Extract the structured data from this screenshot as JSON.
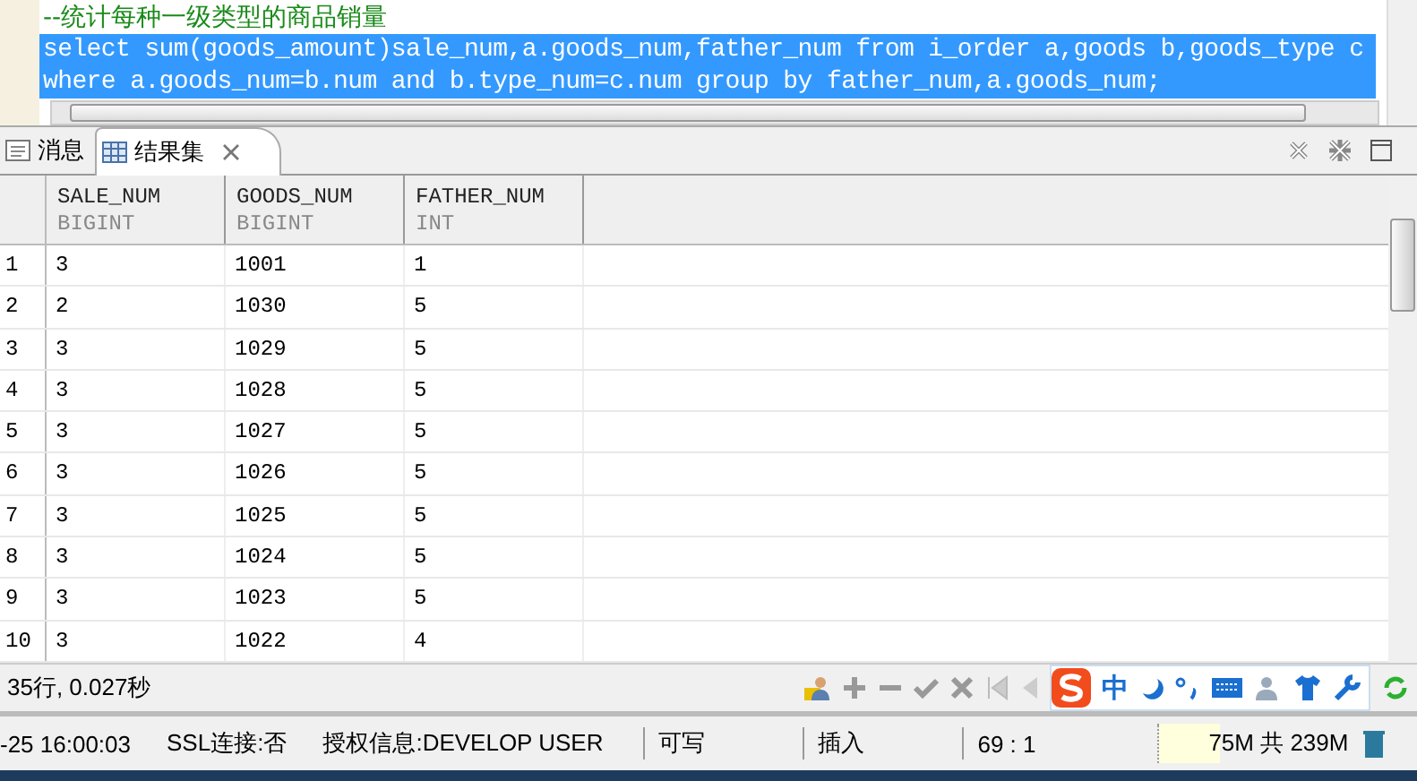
{
  "editor": {
    "lines": [
      {
        "text": "--统计每种一级类型的商品销量",
        "kind": "comment",
        "selected": false
      },
      {
        "text": "select sum(goods_amount)sale_num,a.goods_num,father_num from i_order a,goods b,goods_type c",
        "kind": "code",
        "selected": true
      },
      {
        "text": "where a.goods_num=b.num and b.type_num=c.num group by father_num,a.goods_num;",
        "kind": "code",
        "selected": true
      }
    ]
  },
  "tabs": [
    {
      "label": "消息",
      "selected": false,
      "closable": false
    },
    {
      "label": "结果集",
      "selected": true,
      "closable": true
    }
  ],
  "table": {
    "columns": [
      {
        "name": "SALE_NUM",
        "type": "BIGINT"
      },
      {
        "name": "GOODS_NUM",
        "type": "BIGINT"
      },
      {
        "name": "FATHER_NUM",
        "type": "INT"
      }
    ],
    "rows": [
      {
        "n": "1",
        "cells": [
          "3",
          "1001",
          "1"
        ]
      },
      {
        "n": "2",
        "cells": [
          "2",
          "1030",
          "5"
        ]
      },
      {
        "n": "3",
        "cells": [
          "3",
          "1029",
          "5"
        ]
      },
      {
        "n": "4",
        "cells": [
          "3",
          "1028",
          "5"
        ]
      },
      {
        "n": "5",
        "cells": [
          "3",
          "1027",
          "5"
        ]
      },
      {
        "n": "6",
        "cells": [
          "3",
          "1026",
          "5"
        ]
      },
      {
        "n": "7",
        "cells": [
          "3",
          "1025",
          "5"
        ]
      },
      {
        "n": "8",
        "cells": [
          "3",
          "1024",
          "5"
        ]
      },
      {
        "n": "9",
        "cells": [
          "3",
          "1023",
          "5"
        ]
      },
      {
        "n": "10",
        "cells": [
          "3",
          "1022",
          "4"
        ]
      }
    ]
  },
  "result_info": "35行, 0.027秒",
  "ime": {
    "mode": "中"
  },
  "status_bar": {
    "items": [
      "-25 16:00:03",
      "SSL连接:否",
      "授权信息:DEVELOP USER",
      "可写",
      "插入",
      "69 : 1"
    ],
    "memory": {
      "text": "75M 共 239M",
      "level": 0.31
    }
  }
}
